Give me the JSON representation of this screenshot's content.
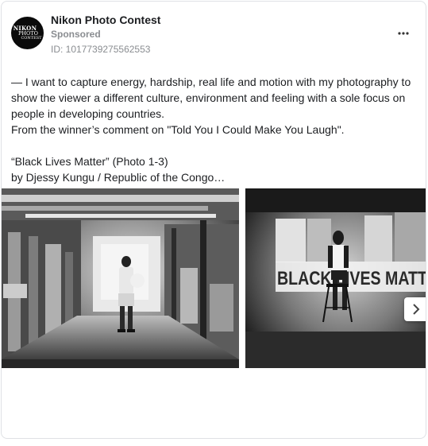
{
  "post": {
    "page_name": "Nikon Photo Contest",
    "sponsored_label": "Sponsored",
    "ad_id": "ID: 1017739275562553",
    "avatar_logo": {
      "line1": "NIKON",
      "line2": "PHOTO",
      "line3": "CONTEST"
    },
    "more_icon": "more-horizontal-icon",
    "text": {
      "line1": "— I want to capture energy, hardship, real life and motion with my photography to show the viewer a different culture, environment and feeling with a sole focus on people in developing countries.",
      "line2": "From the winner’s comment on \"Told You I Could Make You Laugh\".",
      "line3": "“Black Lives Matter” (Photo 1-3)",
      "line4": "by Djessy Kungu / Republic of the Congo…"
    },
    "photos": [
      {
        "alt": "Black-and-white photo of a person standing in an industrial basement corridor"
      },
      {
        "alt": "Black-and-white photo of a person seated on a stool before a Black Lives Matter projection",
        "sign_text": "BLACK LIVES MATT"
      }
    ],
    "next_icon": "chevron-right-icon"
  }
}
